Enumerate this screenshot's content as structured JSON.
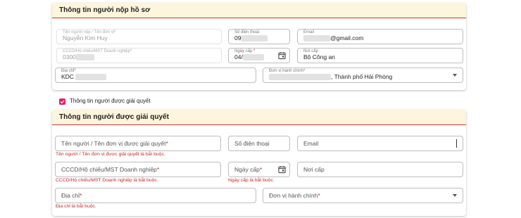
{
  "submitter_section": {
    "title": "Thông tin người nộp hồ sơ",
    "name_label": "Tên người nộp / Tên đơn vị",
    "name_value": "Nguyễn Kim Huy",
    "phone_label": "Số điện thoại",
    "phone_value": "09",
    "email_label": "Email",
    "email_value": "@gmail.com",
    "id_label": "CCCD/Hộ chiếu/MST Doanh nghiệp",
    "id_value": "0300",
    "issue_date_label": "Ngày cấp",
    "issue_date_value": "04/",
    "issue_place_label": "Nơi cấp",
    "issue_place_value": "Bộ Công an",
    "address_label": "Địa chỉ",
    "address_value": "KDC",
    "admin_unit_label": "Đơn vị hành chính",
    "admin_unit_value": ", Thành phố Hải Phòng"
  },
  "resolver_checkbox": {
    "label": "Thông tin người được giải quyết",
    "checked": true
  },
  "resolver_section": {
    "title": "Thông tin người được giải quyết",
    "name_placeholder": "Tên người / Tên đơn vị được giải quyết",
    "name_error": "Tên người / Tên đơn vị được giải quyết là bắt buộc.",
    "phone_placeholder": "Số điện thoại",
    "email_placeholder": "Email",
    "id_placeholder": "CCCD/Hộ chiếu/MST Doanh nghiệp",
    "id_error": "CCCD/Hộ chiếu/MST Doanh nghiệp là bắt buộc.",
    "issue_date_placeholder": "Ngày cấp",
    "issue_date_error": "Ngày cấp là bắt buộc.",
    "issue_place_placeholder": "Nơi cấp",
    "address_placeholder": "Địa chỉ",
    "address_error": "Địa chỉ là bắt buộc.",
    "admin_unit_placeholder": "Đơn vị hành chính"
  },
  "required_mark": "*",
  "colors": {
    "header_bg": "#fdf5dc",
    "header_border": "#c0392b",
    "error": "#c62828",
    "checkbox": "#e91e63"
  }
}
